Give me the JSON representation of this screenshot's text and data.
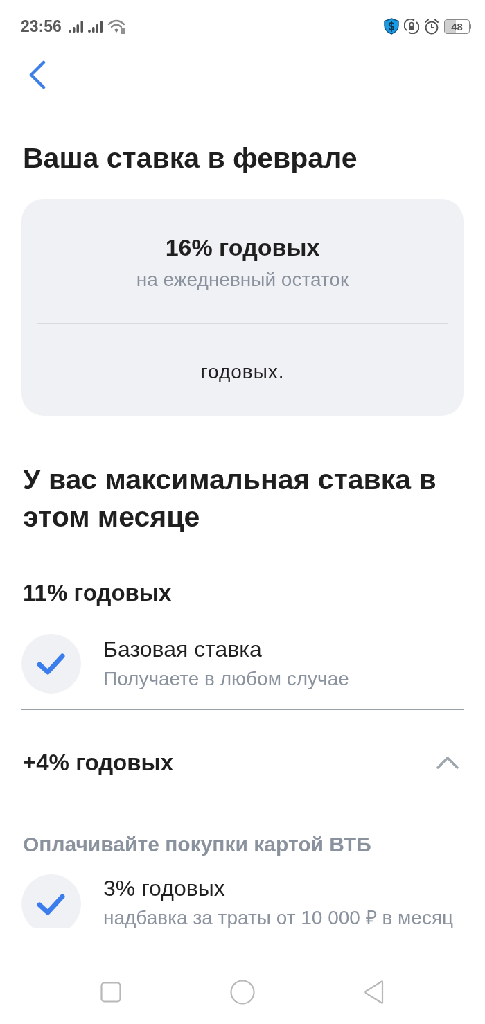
{
  "status_bar": {
    "time": "23:56",
    "battery": "48"
  },
  "title": "Ваша ставка в феврале",
  "rate_card": {
    "rate": "16% годовых",
    "caption": "на ежедневный остаток",
    "note": "годовых."
  },
  "heading": "У вас максимальная ставка в этом месяце",
  "sections": [
    {
      "kind": "plain",
      "title": "11% годовых",
      "conditions": [
        {
          "title": "Базовая ставка",
          "subtitle": "Получаете в любом случае",
          "checked": true
        }
      ]
    },
    {
      "kind": "accordion",
      "title": "+4% годовых",
      "expanded": true,
      "groups": [
        {
          "title": "Оплачивайте покупки картой ВТБ",
          "conditions": [
            {
              "title": "3% годовых",
              "subtitle": "надбавка за траты от 10 000 ₽ в месяц",
              "checked": true
            }
          ]
        }
      ]
    }
  ]
}
